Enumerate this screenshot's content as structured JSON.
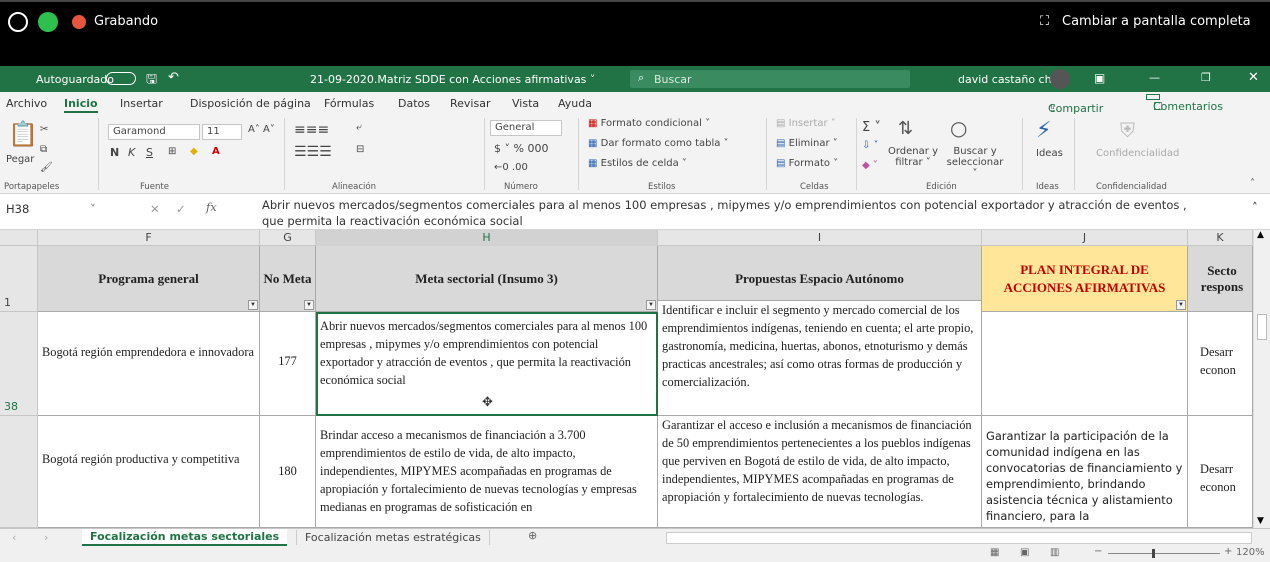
{
  "recorder": {
    "recording_label": "Grabando",
    "fullscreen_label": "Cambiar a pantalla completa"
  },
  "titlebar": {
    "autosave_label": "Autoguardado",
    "filename": "21-09-2020.Matriz SDDE con Acciones afirmativas ˅",
    "search_placeholder": "Buscar",
    "user": "david castaño ch"
  },
  "menu": [
    "Archivo",
    "Inicio",
    "Insertar",
    "Disposición de página",
    "Fórmulas",
    "Datos",
    "Revisar",
    "Vista",
    "Ayuda"
  ],
  "share_label": "Compartir",
  "comments_label": "Comentarios",
  "ribbon": {
    "paste": "Pegar",
    "font_name": "Garamond",
    "font_size": "11",
    "number_format": "General",
    "cond_format": "Formato condicional ˅",
    "table_format": "Dar formato como tabla ˅",
    "cell_styles": "Estilos de celda ˅",
    "insert": "Insertar ˅",
    "delete": "Eliminar ˅",
    "format": "Formato ˅",
    "sort": "Ordenar y filtrar ˅",
    "find": "Buscar y seleccionar ˅",
    "ideas": "Ideas",
    "confidentiality": "Confidencialidad",
    "groups": [
      "Portapapeles",
      "Fuente",
      "Alineación",
      "Número",
      "Estilos",
      "Celdas",
      "Edición",
      "Ideas",
      "Confidencialidad"
    ]
  },
  "formula_bar": {
    "cell_ref": "H38",
    "fx": "fx",
    "content_line1": "Abrir nuevos mercados/segmentos comerciales para al menos 100 empresas , mipymes y/o emprendimientos  con potencial exportador  y atracción de eventos ,",
    "content_line2": "que permita la reactivación económica social"
  },
  "columns": [
    "F",
    "G",
    "H",
    "I",
    "J",
    "K"
  ],
  "headers": {
    "f": "Programa general",
    "g": "No Meta",
    "h": "Meta sectorial (Insumo 3)",
    "i": "Propuestas Espacio Autónomo",
    "j": "PLAN INTEGRAL DE ACCIONES AFIRMATIVAS",
    "k": "Secto respons"
  },
  "rows": [
    {
      "num": "38",
      "f": "Bogotá región emprendedora e innovadora",
      "g": "177",
      "h": "Abrir nuevos mercados/segmentos comerciales para al menos 100 empresas , mipymes y/o emprendimientos  con potencial exportador  y atracción de eventos , que permita la reactivación económica social",
      "i": "Identificar e incluir el segmento y mercado comercial de los  emprendimientos indígenas, teniendo en cuenta;  el arte propio, gastronomía, medicina, huertas, abonos, etnoturismo y demás practicas ancestrales; así como otras formas de producción y comercialización.",
      "j": "",
      "k": "Desarr econon"
    },
    {
      "num": "",
      "f": "Bogotá región productiva y competitiva",
      "g": "180",
      "h": "Brindar acceso a mecanismos de financiación a 3.700 emprendimientos de estilo de vida, de alto impacto, independientes, MIPYMES acompañadas en programas de apropiación y fortalecimiento de nuevas tecnologías y empresas medianas en programas de sofisticación en",
      "i": "Garantizar el acceso e inclusión a mecanismos de financiación de 50 emprendimientos pertenecientes a los pueblos indígenas que perviven en Bogotá de estilo de vida, de alto impacto, independientes, MIPYMES acompañadas en programas de apropiación y fortalecimiento de nuevas tecnologías.",
      "j": "Garantizar la participación de la comunidad indígena en las convocatorias de financiamiento y emprendimiento, brindando asistencia técnica y alistamiento financiero, para la",
      "k": "Desarr econon"
    }
  ],
  "header_row_num": "1",
  "sheets": [
    "Focalización metas sectoriales",
    "Focalización metas estratégicas"
  ],
  "zoom": "120%",
  "colors": {
    "excel_green": "#217346",
    "header_fill": "#d9d9d9",
    "plan_fill": "#ffe699",
    "plan_text": "#c00000"
  }
}
